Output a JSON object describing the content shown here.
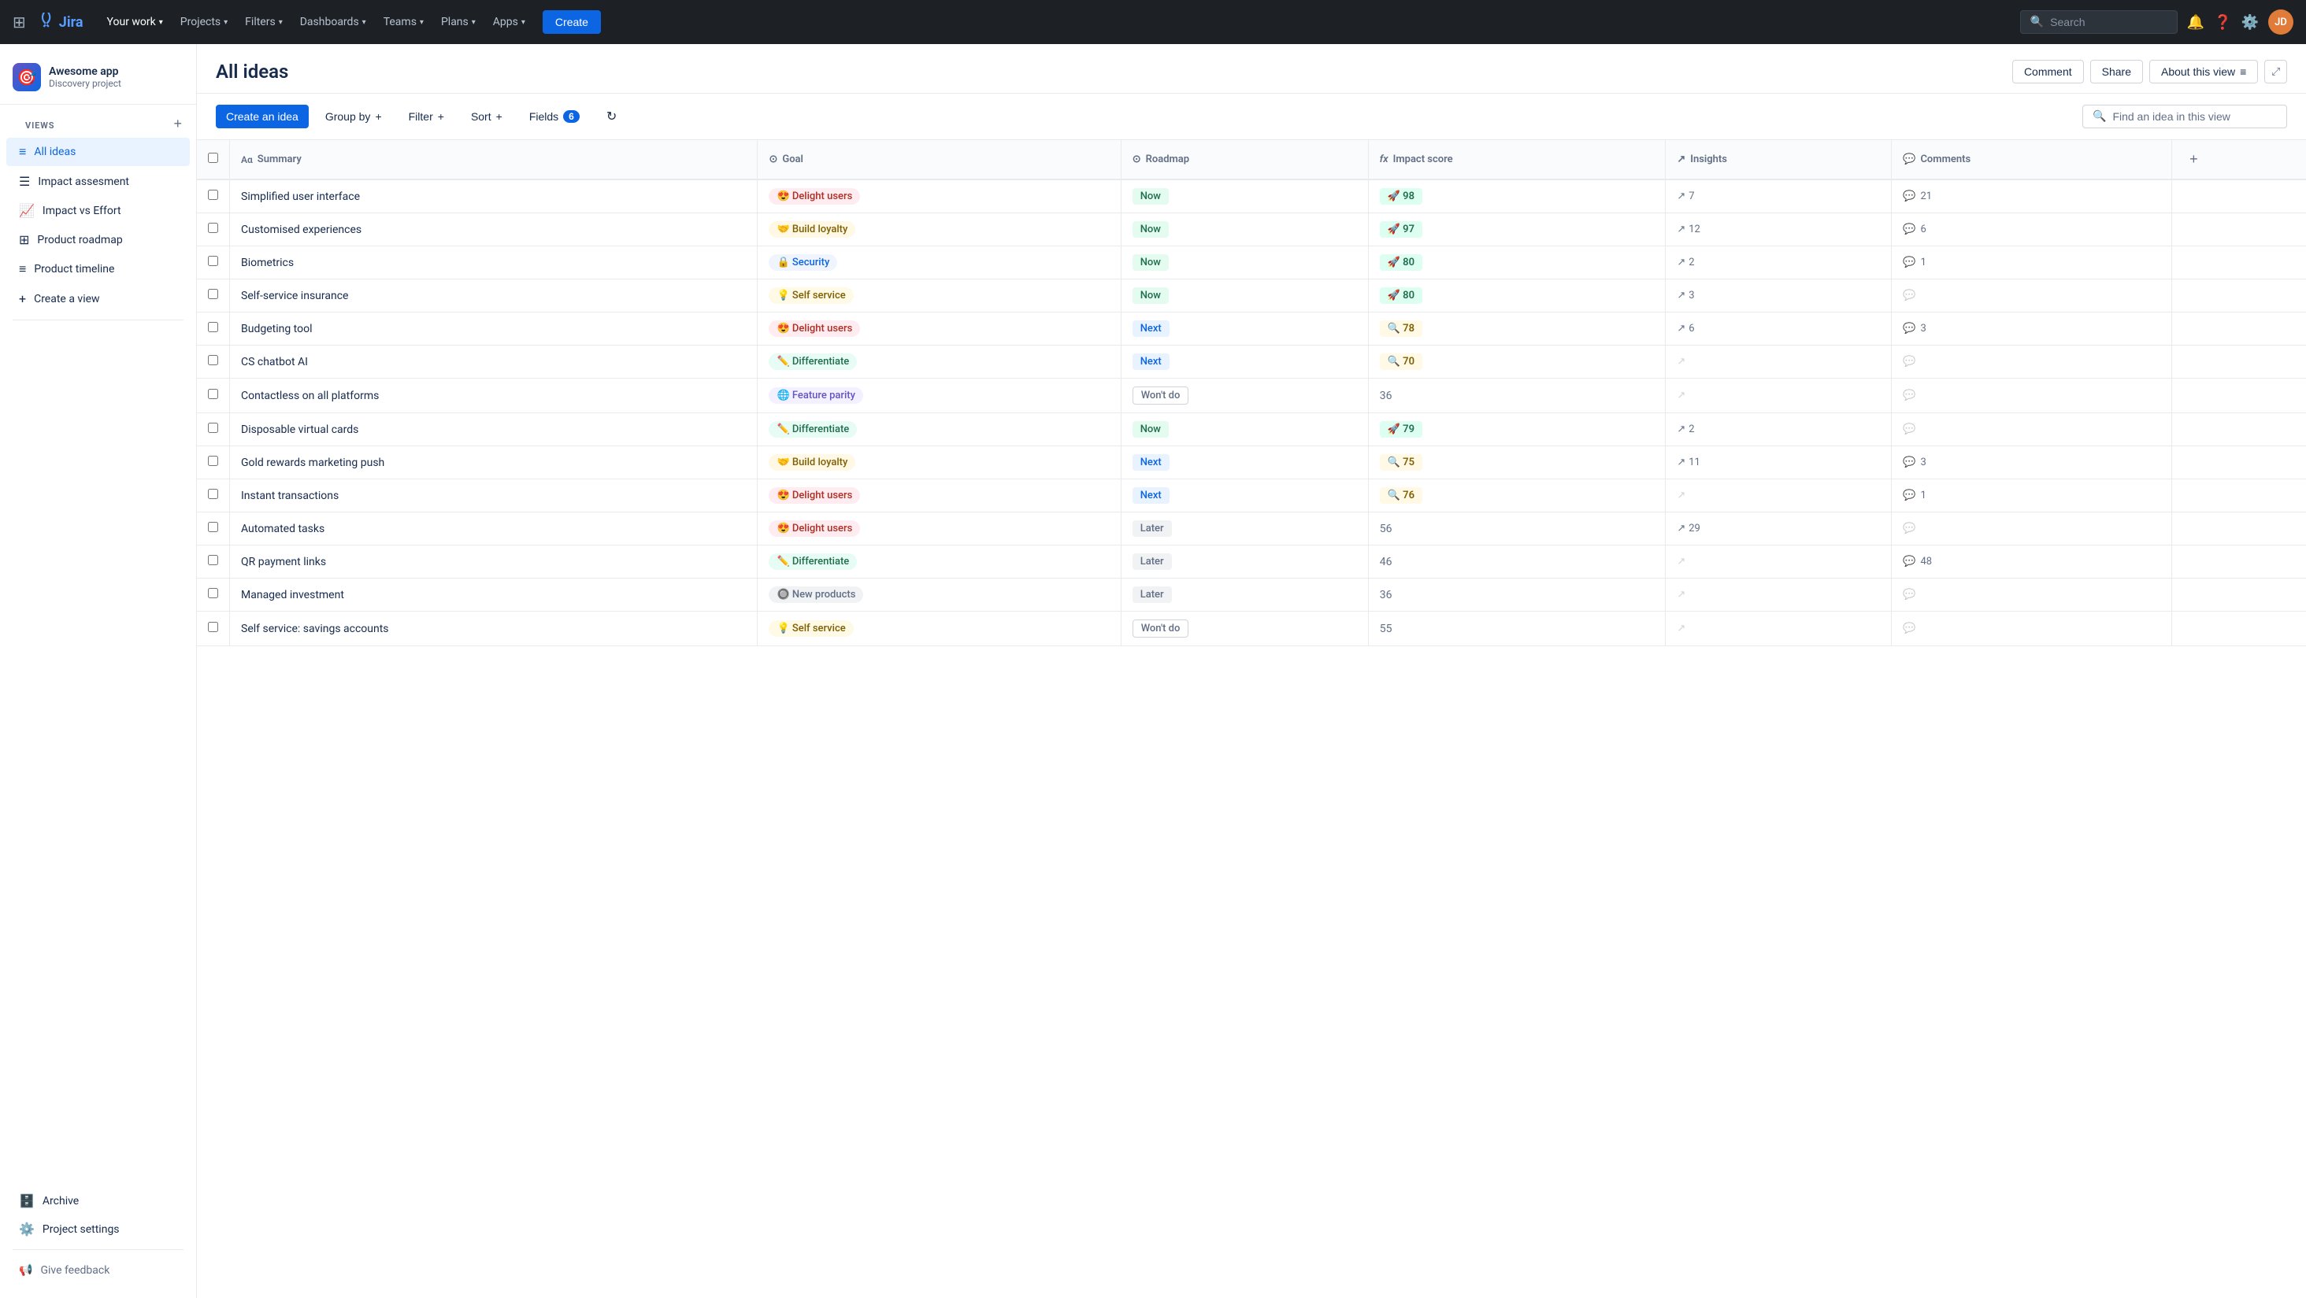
{
  "topnav": {
    "logo_text": "Jira",
    "nav_items": [
      {
        "label": "Your work",
        "has_chevron": true,
        "active": true
      },
      {
        "label": "Projects",
        "has_chevron": true
      },
      {
        "label": "Filters",
        "has_chevron": true
      },
      {
        "label": "Dashboards",
        "has_chevron": true
      },
      {
        "label": "Teams",
        "has_chevron": true
      },
      {
        "label": "Plans",
        "has_chevron": true
      },
      {
        "label": "Apps",
        "has_chevron": true
      }
    ],
    "create_label": "Create",
    "search_placeholder": "Search"
  },
  "sidebar": {
    "project_name": "Awesome app",
    "project_type": "Discovery project",
    "views_label": "VIEWS",
    "views": [
      {
        "label": "All ideas",
        "icon": "≡",
        "active": true
      },
      {
        "label": "Impact assesment",
        "icon": "☰"
      },
      {
        "label": "Impact vs Effort",
        "icon": "📈"
      },
      {
        "label": "Product roadmap",
        "icon": "⊞"
      },
      {
        "label": "Product timeline",
        "icon": "≡"
      },
      {
        "label": "Create a view",
        "icon": "+"
      }
    ],
    "archive_label": "Archive",
    "project_settings_label": "Project settings",
    "feedback_label": "Give feedback"
  },
  "page": {
    "title": "All ideas",
    "actions": {
      "comment_label": "Comment",
      "share_label": "Share",
      "about_label": "About this view"
    }
  },
  "toolbar": {
    "create_idea_label": "Create an idea",
    "group_by_label": "Group by",
    "filter_label": "Filter",
    "sort_label": "Sort",
    "fields_label": "Fields",
    "fields_count": "6",
    "search_placeholder": "Find an idea in this view"
  },
  "table": {
    "columns": [
      {
        "key": "summary",
        "label": "Summary",
        "icon": "Aα"
      },
      {
        "key": "goal",
        "label": "Goal",
        "icon": "⊙"
      },
      {
        "key": "roadmap",
        "label": "Roadmap",
        "icon": "⊙"
      },
      {
        "key": "impact_score",
        "label": "Impact score",
        "icon": "fx"
      },
      {
        "key": "insights",
        "label": "Insights",
        "icon": "↗"
      },
      {
        "key": "comments",
        "label": "Comments",
        "icon": "💬"
      }
    ],
    "rows": [
      {
        "summary": "Simplified user interface",
        "goal": "Delight users",
        "goal_class": "goal-delight",
        "goal_emoji": "😍",
        "roadmap": "Now",
        "road_class": "road-now",
        "impact_score": "98",
        "impact_emoji": "🚀",
        "impact_class": "impact-high",
        "insights": "7",
        "insights_has": true,
        "comments": "21",
        "comments_has": true
      },
      {
        "summary": "Customised experiences",
        "goal": "Build loyalty",
        "goal_class": "goal-loyalty",
        "goal_emoji": "🤝",
        "roadmap": "Now",
        "road_class": "road-now",
        "impact_score": "97",
        "impact_emoji": "🚀",
        "impact_class": "impact-high",
        "insights": "12",
        "insights_has": true,
        "comments": "6",
        "comments_has": true
      },
      {
        "summary": "Biometrics",
        "goal": "Security",
        "goal_class": "goal-security",
        "goal_emoji": "🔒",
        "roadmap": "Now",
        "road_class": "road-now",
        "impact_score": "80",
        "impact_emoji": "🚀",
        "impact_class": "impact-high",
        "insights": "2",
        "insights_has": true,
        "comments": "1",
        "comments_has": true
      },
      {
        "summary": "Self-service insurance",
        "goal": "Self service",
        "goal_class": "goal-selfservice",
        "goal_emoji": "💡",
        "roadmap": "Now",
        "road_class": "road-now",
        "impact_score": "80",
        "impact_emoji": "🚀",
        "impact_class": "impact-high",
        "insights": "3",
        "insights_has": true,
        "comments": "",
        "comments_has": false
      },
      {
        "summary": "Budgeting tool",
        "goal": "Delight users",
        "goal_class": "goal-delight",
        "goal_emoji": "😍",
        "roadmap": "Next",
        "road_class": "road-next",
        "impact_score": "78",
        "impact_emoji": "🔍",
        "impact_class": "impact-med",
        "insights": "6",
        "insights_has": true,
        "comments": "3",
        "comments_has": true
      },
      {
        "summary": "CS chatbot AI",
        "goal": "Differentiate",
        "goal_class": "goal-differentiate",
        "goal_emoji": "✏️",
        "roadmap": "Next",
        "road_class": "road-next",
        "impact_score": "70",
        "impact_emoji": "🔍",
        "impact_class": "impact-med",
        "insights": "",
        "insights_has": false,
        "comments": "",
        "comments_has": false
      },
      {
        "summary": "Contactless on all platforms",
        "goal": "Feature parity",
        "goal_class": "goal-featureparity",
        "goal_emoji": "🌐",
        "roadmap": "Won't do",
        "road_class": "road-wont",
        "impact_score": "36",
        "impact_emoji": "",
        "impact_class": "impact-low",
        "insights": "",
        "insights_has": false,
        "comments": "",
        "comments_has": false
      },
      {
        "summary": "Disposable virtual cards",
        "goal": "Differentiate",
        "goal_class": "goal-differentiate",
        "goal_emoji": "✏️",
        "roadmap": "Now",
        "road_class": "road-now",
        "impact_score": "79",
        "impact_emoji": "🚀",
        "impact_class": "impact-high",
        "insights": "2",
        "insights_has": true,
        "comments": "",
        "comments_has": false
      },
      {
        "summary": "Gold rewards marketing push",
        "goal": "Build loyalty",
        "goal_class": "goal-loyalty",
        "goal_emoji": "🤝",
        "roadmap": "Next",
        "road_class": "road-next",
        "impact_score": "75",
        "impact_emoji": "🔍",
        "impact_class": "impact-med",
        "insights": "11",
        "insights_has": true,
        "comments": "3",
        "comments_has": true
      },
      {
        "summary": "Instant transactions",
        "goal": "Delight users",
        "goal_class": "goal-delight",
        "goal_emoji": "😍",
        "roadmap": "Next",
        "road_class": "road-next",
        "impact_score": "76",
        "impact_emoji": "🔍",
        "impact_class": "impact-med",
        "insights": "",
        "insights_has": false,
        "comments": "1",
        "comments_has": true
      },
      {
        "summary": "Automated tasks",
        "goal": "Delight users",
        "goal_class": "goal-delight",
        "goal_emoji": "😍",
        "roadmap": "Later",
        "road_class": "road-later",
        "impact_score": "56",
        "impact_emoji": "",
        "impact_class": "impact-low",
        "insights": "29",
        "insights_has": true,
        "comments": "",
        "comments_has": false
      },
      {
        "summary": "QR payment links",
        "goal": "Differentiate",
        "goal_class": "goal-differentiate",
        "goal_emoji": "✏️",
        "roadmap": "Later",
        "road_class": "road-later",
        "impact_score": "46",
        "impact_emoji": "",
        "impact_class": "impact-low",
        "insights": "",
        "insights_has": false,
        "comments": "48",
        "comments_has": true
      },
      {
        "summary": "Managed investment",
        "goal": "New products",
        "goal_class": "goal-newproducts",
        "goal_emoji": "🔘",
        "roadmap": "Later",
        "road_class": "road-later",
        "impact_score": "36",
        "impact_emoji": "",
        "impact_class": "impact-low",
        "insights": "",
        "insights_has": false,
        "comments": "",
        "comments_has": false
      },
      {
        "summary": "Self service: savings accounts",
        "goal": "Self service",
        "goal_class": "goal-selfservice",
        "goal_emoji": "💡",
        "roadmap": "Won't do",
        "road_class": "road-wont",
        "impact_score": "55",
        "impact_emoji": "",
        "impact_class": "impact-low",
        "insights": "",
        "insights_has": false,
        "comments": "",
        "comments_has": false
      }
    ]
  }
}
